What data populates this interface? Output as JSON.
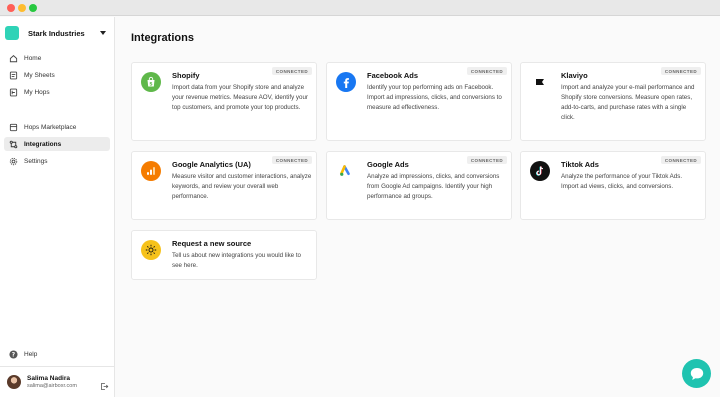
{
  "org": {
    "name": "Stark Industries",
    "color": "#2fd3b7"
  },
  "nav": {
    "home": "Home",
    "sheets": "My Sheets",
    "hops": "My Hops",
    "marketplace": "Hops Marketplace",
    "integrations": "Integrations",
    "settings": "Settings",
    "help": "Help"
  },
  "user": {
    "name": "Salima Nadira",
    "email": "salima@airboxr.com"
  },
  "page": {
    "title": "Integrations"
  },
  "badge": "CONNECTED",
  "cards": [
    {
      "title": "Shopify",
      "desc": "Import data from your Shopify store and analyze your revenue metrics. Measure AOV, identify your top customers, and promote your top products.",
      "icon": "shopify-icon",
      "color": "#5fb84a"
    },
    {
      "title": "Facebook Ads",
      "desc": "Identify your top performing ads on Facebook. Import ad impressions, clicks, and conversions to measure ad effectiveness.",
      "icon": "facebook-icon",
      "color": "#1877f2"
    },
    {
      "title": "Klaviyo",
      "desc": "Import and analyze your e-mail performance and Shopify store conversions. Measure open rates, add-to-carts, and purchase rates with a single click.",
      "icon": "klaviyo-icon",
      "color": "#ffffff"
    },
    {
      "title": "Google Analytics (UA)",
      "desc": "Measure visitor and customer interactions, analyze keywords, and review your overall web performance.",
      "icon": "google-analytics-icon",
      "color": "#f57c00"
    },
    {
      "title": "Google Ads",
      "desc": "Analyze ad impressions, clicks, and conversions from Google Ad campaigns. Identify your high performance ad groups.",
      "icon": "google-ads-icon",
      "color": "#ffffff"
    },
    {
      "title": "Tiktok Ads",
      "desc": "Analyze the performance of your Tiktok Ads. Import ad views, clicks, and conversions.",
      "icon": "tiktok-icon",
      "color": "#111111"
    },
    {
      "title": "Request a new source",
      "desc": "Tell us about new integrations you would like to see here.",
      "icon": "sun-icon",
      "color": "#f6c21b"
    }
  ],
  "chat": {
    "icon": "chat-icon",
    "color": "#1fc3b0"
  }
}
